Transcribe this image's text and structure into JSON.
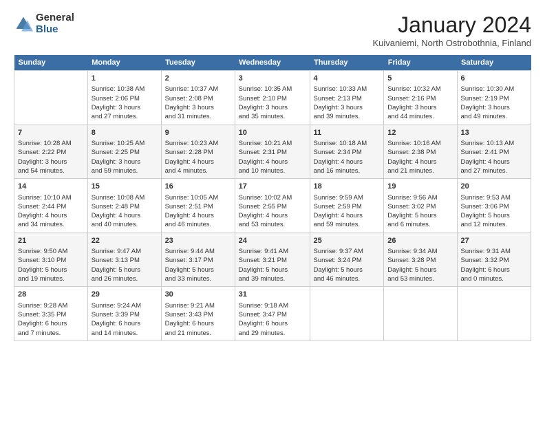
{
  "header": {
    "logo_general": "General",
    "logo_blue": "Blue",
    "title": "January 2024",
    "subtitle": "Kuivaniemi, North Ostrobothnia, Finland"
  },
  "weekdays": [
    "Sunday",
    "Monday",
    "Tuesday",
    "Wednesday",
    "Thursday",
    "Friday",
    "Saturday"
  ],
  "weeks": [
    [
      {
        "day": "",
        "content": ""
      },
      {
        "day": "1",
        "content": "Sunrise: 10:38 AM\nSunset: 2:06 PM\nDaylight: 3 hours\nand 27 minutes."
      },
      {
        "day": "2",
        "content": "Sunrise: 10:37 AM\nSunset: 2:08 PM\nDaylight: 3 hours\nand 31 minutes."
      },
      {
        "day": "3",
        "content": "Sunrise: 10:35 AM\nSunset: 2:10 PM\nDaylight: 3 hours\nand 35 minutes."
      },
      {
        "day": "4",
        "content": "Sunrise: 10:33 AM\nSunset: 2:13 PM\nDaylight: 3 hours\nand 39 minutes."
      },
      {
        "day": "5",
        "content": "Sunrise: 10:32 AM\nSunset: 2:16 PM\nDaylight: 3 hours\nand 44 minutes."
      },
      {
        "day": "6",
        "content": "Sunrise: 10:30 AM\nSunset: 2:19 PM\nDaylight: 3 hours\nand 49 minutes."
      }
    ],
    [
      {
        "day": "7",
        "content": "Sunrise: 10:28 AM\nSunset: 2:22 PM\nDaylight: 3 hours\nand 54 minutes."
      },
      {
        "day": "8",
        "content": "Sunrise: 10:25 AM\nSunset: 2:25 PM\nDaylight: 3 hours\nand 59 minutes."
      },
      {
        "day": "9",
        "content": "Sunrise: 10:23 AM\nSunset: 2:28 PM\nDaylight: 4 hours\nand 4 minutes."
      },
      {
        "day": "10",
        "content": "Sunrise: 10:21 AM\nSunset: 2:31 PM\nDaylight: 4 hours\nand 10 minutes."
      },
      {
        "day": "11",
        "content": "Sunrise: 10:18 AM\nSunset: 2:34 PM\nDaylight: 4 hours\nand 16 minutes."
      },
      {
        "day": "12",
        "content": "Sunrise: 10:16 AM\nSunset: 2:38 PM\nDaylight: 4 hours\nand 21 minutes."
      },
      {
        "day": "13",
        "content": "Sunrise: 10:13 AM\nSunset: 2:41 PM\nDaylight: 4 hours\nand 27 minutes."
      }
    ],
    [
      {
        "day": "14",
        "content": "Sunrise: 10:10 AM\nSunset: 2:44 PM\nDaylight: 4 hours\nand 34 minutes."
      },
      {
        "day": "15",
        "content": "Sunrise: 10:08 AM\nSunset: 2:48 PM\nDaylight: 4 hours\nand 40 minutes."
      },
      {
        "day": "16",
        "content": "Sunrise: 10:05 AM\nSunset: 2:51 PM\nDaylight: 4 hours\nand 46 minutes."
      },
      {
        "day": "17",
        "content": "Sunrise: 10:02 AM\nSunset: 2:55 PM\nDaylight: 4 hours\nand 53 minutes."
      },
      {
        "day": "18",
        "content": "Sunrise: 9:59 AM\nSunset: 2:59 PM\nDaylight: 4 hours\nand 59 minutes."
      },
      {
        "day": "19",
        "content": "Sunrise: 9:56 AM\nSunset: 3:02 PM\nDaylight: 5 hours\nand 6 minutes."
      },
      {
        "day": "20",
        "content": "Sunrise: 9:53 AM\nSunset: 3:06 PM\nDaylight: 5 hours\nand 12 minutes."
      }
    ],
    [
      {
        "day": "21",
        "content": "Sunrise: 9:50 AM\nSunset: 3:10 PM\nDaylight: 5 hours\nand 19 minutes."
      },
      {
        "day": "22",
        "content": "Sunrise: 9:47 AM\nSunset: 3:13 PM\nDaylight: 5 hours\nand 26 minutes."
      },
      {
        "day": "23",
        "content": "Sunrise: 9:44 AM\nSunset: 3:17 PM\nDaylight: 5 hours\nand 33 minutes."
      },
      {
        "day": "24",
        "content": "Sunrise: 9:41 AM\nSunset: 3:21 PM\nDaylight: 5 hours\nand 39 minutes."
      },
      {
        "day": "25",
        "content": "Sunrise: 9:37 AM\nSunset: 3:24 PM\nDaylight: 5 hours\nand 46 minutes."
      },
      {
        "day": "26",
        "content": "Sunrise: 9:34 AM\nSunset: 3:28 PM\nDaylight: 5 hours\nand 53 minutes."
      },
      {
        "day": "27",
        "content": "Sunrise: 9:31 AM\nSunset: 3:32 PM\nDaylight: 6 hours\nand 0 minutes."
      }
    ],
    [
      {
        "day": "28",
        "content": "Sunrise: 9:28 AM\nSunset: 3:35 PM\nDaylight: 6 hours\nand 7 minutes."
      },
      {
        "day": "29",
        "content": "Sunrise: 9:24 AM\nSunset: 3:39 PM\nDaylight: 6 hours\nand 14 minutes."
      },
      {
        "day": "30",
        "content": "Sunrise: 9:21 AM\nSunset: 3:43 PM\nDaylight: 6 hours\nand 21 minutes."
      },
      {
        "day": "31",
        "content": "Sunrise: 9:18 AM\nSunset: 3:47 PM\nDaylight: 6 hours\nand 29 minutes."
      },
      {
        "day": "",
        "content": ""
      },
      {
        "day": "",
        "content": ""
      },
      {
        "day": "",
        "content": ""
      }
    ]
  ]
}
